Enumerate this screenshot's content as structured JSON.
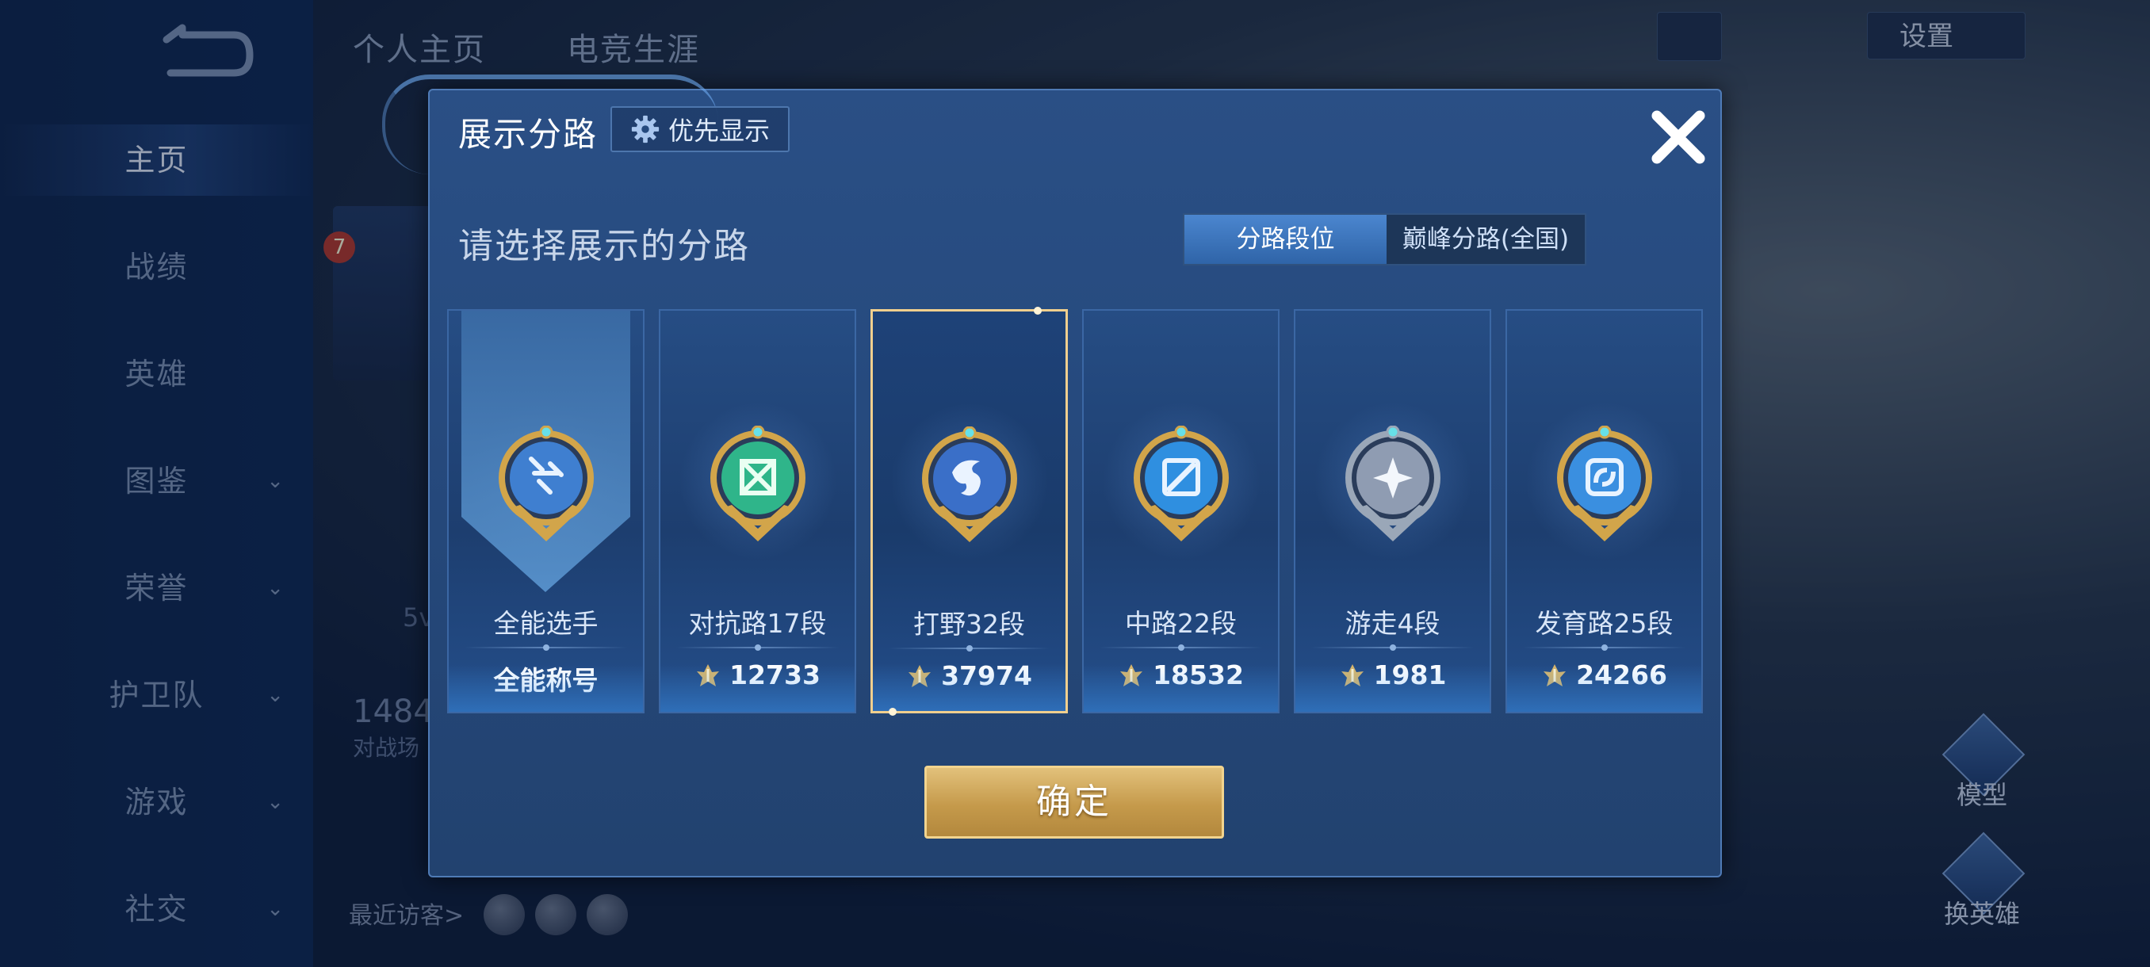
{
  "sidebar": {
    "items": [
      {
        "label": "主页",
        "chevron": false,
        "active": true
      },
      {
        "label": "战绩",
        "chevron": false
      },
      {
        "label": "英雄",
        "chevron": false
      },
      {
        "label": "图鉴",
        "chevron": true
      },
      {
        "label": "荣誉",
        "chevron": true
      },
      {
        "label": "护卫队",
        "chevron": true
      },
      {
        "label": "游戏",
        "chevron": true
      },
      {
        "label": "社交",
        "chevron": true
      }
    ],
    "chevron_glyph": "⌄"
  },
  "background": {
    "tabs": [
      "个人主页",
      "电竞生涯"
    ],
    "settings_label": "设置",
    "stat_number": "1484",
    "stat_caption": "对战场",
    "level_badge": "7",
    "side_snippet": "5v",
    "visitors_label": "最近访客>",
    "right_buttons": [
      "模型",
      "换英雄"
    ]
  },
  "modal": {
    "title": "展示分路",
    "priority_button": "优先显示",
    "subtitle": "请选择展示的分路",
    "toggle": {
      "active": "分路段位",
      "inactive": "巅峰分路(全国)"
    },
    "confirm": "确定",
    "lanes": [
      {
        "label": "全能选手",
        "value": "全能称号",
        "has_peak_icon": false,
        "selected": false,
        "medal": "all-round",
        "ring": "#d2a54a"
      },
      {
        "label": "对抗路17段",
        "value": "12733",
        "has_peak_icon": true,
        "selected": false,
        "medal": "clash",
        "ring": "#d2a54a"
      },
      {
        "label": "打野32段",
        "value": "37974",
        "has_peak_icon": true,
        "selected": true,
        "medal": "jungle",
        "ring": "#d2a54a"
      },
      {
        "label": "中路22段",
        "value": "18532",
        "has_peak_icon": true,
        "selected": false,
        "medal": "mid",
        "ring": "#d2a54a"
      },
      {
        "label": "游走4段",
        "value": "1981",
        "has_peak_icon": true,
        "selected": false,
        "medal": "roam",
        "ring": "#9aa7b8"
      },
      {
        "label": "发育路25段",
        "value": "24266",
        "has_peak_icon": true,
        "selected": false,
        "medal": "farm",
        "ring": "#d2a54a"
      }
    ]
  },
  "colors": {
    "accent_gold": "#f0cf8e",
    "toggle_active": "#3f78c0",
    "panel": "#264a7e"
  },
  "icons": [
    "back-icon",
    "gear-icon",
    "close-icon",
    "peak-score-icon",
    "chevron-down-icon"
  ]
}
